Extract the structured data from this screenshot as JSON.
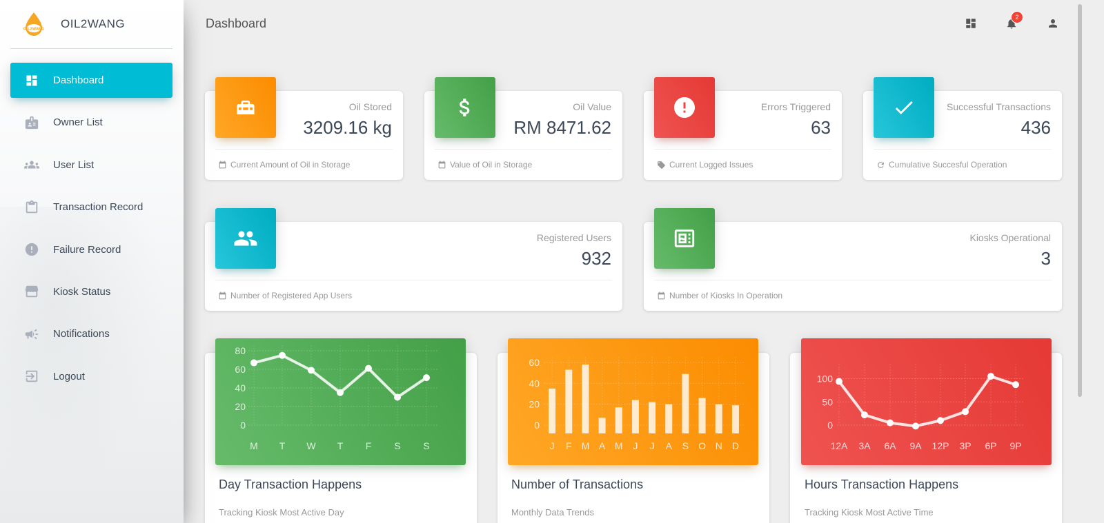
{
  "brand": {
    "name": "OIL2WANG",
    "logo_text": "OIL2WANG"
  },
  "sidebar": {
    "items": [
      {
        "label": "Dashboard",
        "icon": "dashboard-icon",
        "active": true
      },
      {
        "label": "Owner List",
        "icon": "badge-icon"
      },
      {
        "label": "User List",
        "icon": "people-icon"
      },
      {
        "label": "Transaction Record",
        "icon": "clipboard-icon"
      },
      {
        "label": "Failure Record",
        "icon": "error-icon"
      },
      {
        "label": "Kiosk Status",
        "icon": "store-icon"
      },
      {
        "label": "Notifications",
        "icon": "megaphone-icon"
      },
      {
        "label": "Logout",
        "icon": "logout-icon"
      }
    ]
  },
  "header": {
    "title": "Dashboard",
    "notification_count": "2"
  },
  "stats": [
    {
      "category": "Oil Stored",
      "value": "3209.16 kg",
      "footer": "Current Amount of Oil in Storage",
      "icon": "toolbox-icon",
      "footer_icon": "calendar-icon",
      "color": "#fb8c00"
    },
    {
      "category": "Oil Value",
      "value": "RM 8471.62",
      "footer": "Value of Oil in Storage",
      "icon": "dollar-icon",
      "footer_icon": "calendar-icon",
      "color": "#43a047"
    },
    {
      "category": "Errors Triggered",
      "value": "63",
      "footer": "Current Logged Issues",
      "icon": "error-icon",
      "footer_icon": "tag-icon",
      "color": "#e53935"
    },
    {
      "category": "Successful Transactions",
      "value": "436",
      "footer": "Cumulative Succesful Operation",
      "icon": "check-icon",
      "footer_icon": "refresh-icon",
      "color": "#00acc1"
    },
    {
      "category": "Registered Users",
      "value": "932",
      "footer": "Number of Registered App Users",
      "icon": "people-icon",
      "footer_icon": "calendar-icon",
      "color": "#00acc1"
    },
    {
      "category": "Kiosks Operational",
      "value": "3",
      "footer": "Number of Kiosks In Operation",
      "icon": "kiosk-icon",
      "footer_icon": "calendar-icon",
      "color": "#43a047"
    }
  ],
  "charts": [
    {
      "title": "Day Transaction Happens",
      "subtitle": "Tracking Kiosk Most Active Day",
      "color": "#43a047"
    },
    {
      "title": "Number of Transactions",
      "subtitle": "Monthly Data Trends",
      "color": "#fb8c00"
    },
    {
      "title": "Hours Transaction Happens",
      "subtitle": "Tracking Kiosk Most Active Time",
      "color": "#e53935"
    }
  ],
  "chart_data": [
    {
      "type": "line",
      "categories": [
        "M",
        "T",
        "W",
        "T",
        "F",
        "S",
        "S"
      ],
      "values": [
        67,
        75,
        59,
        35,
        61,
        30,
        51
      ],
      "yticks": [
        0,
        20,
        40,
        60,
        80
      ],
      "ylim": [
        0,
        80
      ],
      "grid": true
    },
    {
      "type": "bar",
      "categories": [
        "J",
        "F",
        "M",
        "A",
        "M",
        "J",
        "J",
        "A",
        "S",
        "O",
        "N",
        "D"
      ],
      "values": [
        35,
        53,
        58,
        7,
        17,
        24,
        22,
        20,
        49,
        26,
        20,
        19
      ],
      "yticks": [
        0,
        20,
        40,
        60
      ],
      "ylim": [
        0,
        60
      ],
      "grid": true
    },
    {
      "type": "line",
      "categories": [
        "12A",
        "3A",
        "6A",
        "9A",
        "12P",
        "3P",
        "6P",
        "9P"
      ],
      "values": [
        94,
        22,
        5,
        -2,
        10,
        29,
        105,
        87
      ],
      "yticks": [
        0,
        50,
        100
      ],
      "ylim": [
        0,
        120
      ],
      "grid": true
    }
  ]
}
